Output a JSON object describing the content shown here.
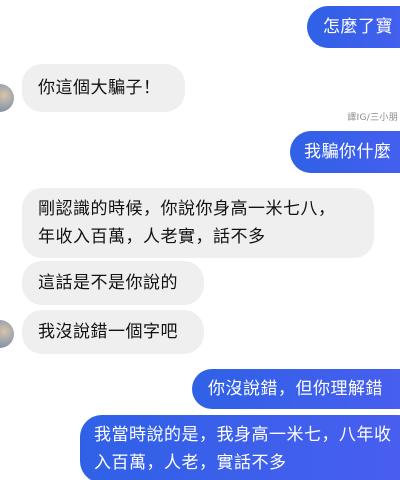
{
  "messages": [
    {
      "side": "outgoing",
      "text": "怎麼了寶"
    },
    {
      "side": "incoming",
      "text": "你這個大騙子！"
    },
    {
      "side": "outgoing",
      "text": "我騙你什麼"
    },
    {
      "side": "incoming",
      "lines": [
        "剛認識的時候，你說你身高一米七八，",
        "年收入百萬，人老實，話不多"
      ]
    },
    {
      "side": "incoming",
      "text": "這話是不是你說的"
    },
    {
      "side": "incoming",
      "text": "我沒說錯一個字吧"
    },
    {
      "side": "outgoing",
      "text": "你沒說錯，但你理解錯"
    },
    {
      "side": "outgoing",
      "lines": [
        "我當時說的是，我身高一米七，八年收",
        "入百萬，人老，實話不多"
      ]
    }
  ],
  "watermark": "譯IG/三小朋",
  "colors": {
    "outgoing_bubble": "#3f6fe8",
    "incoming_bubble": "#efefef"
  }
}
